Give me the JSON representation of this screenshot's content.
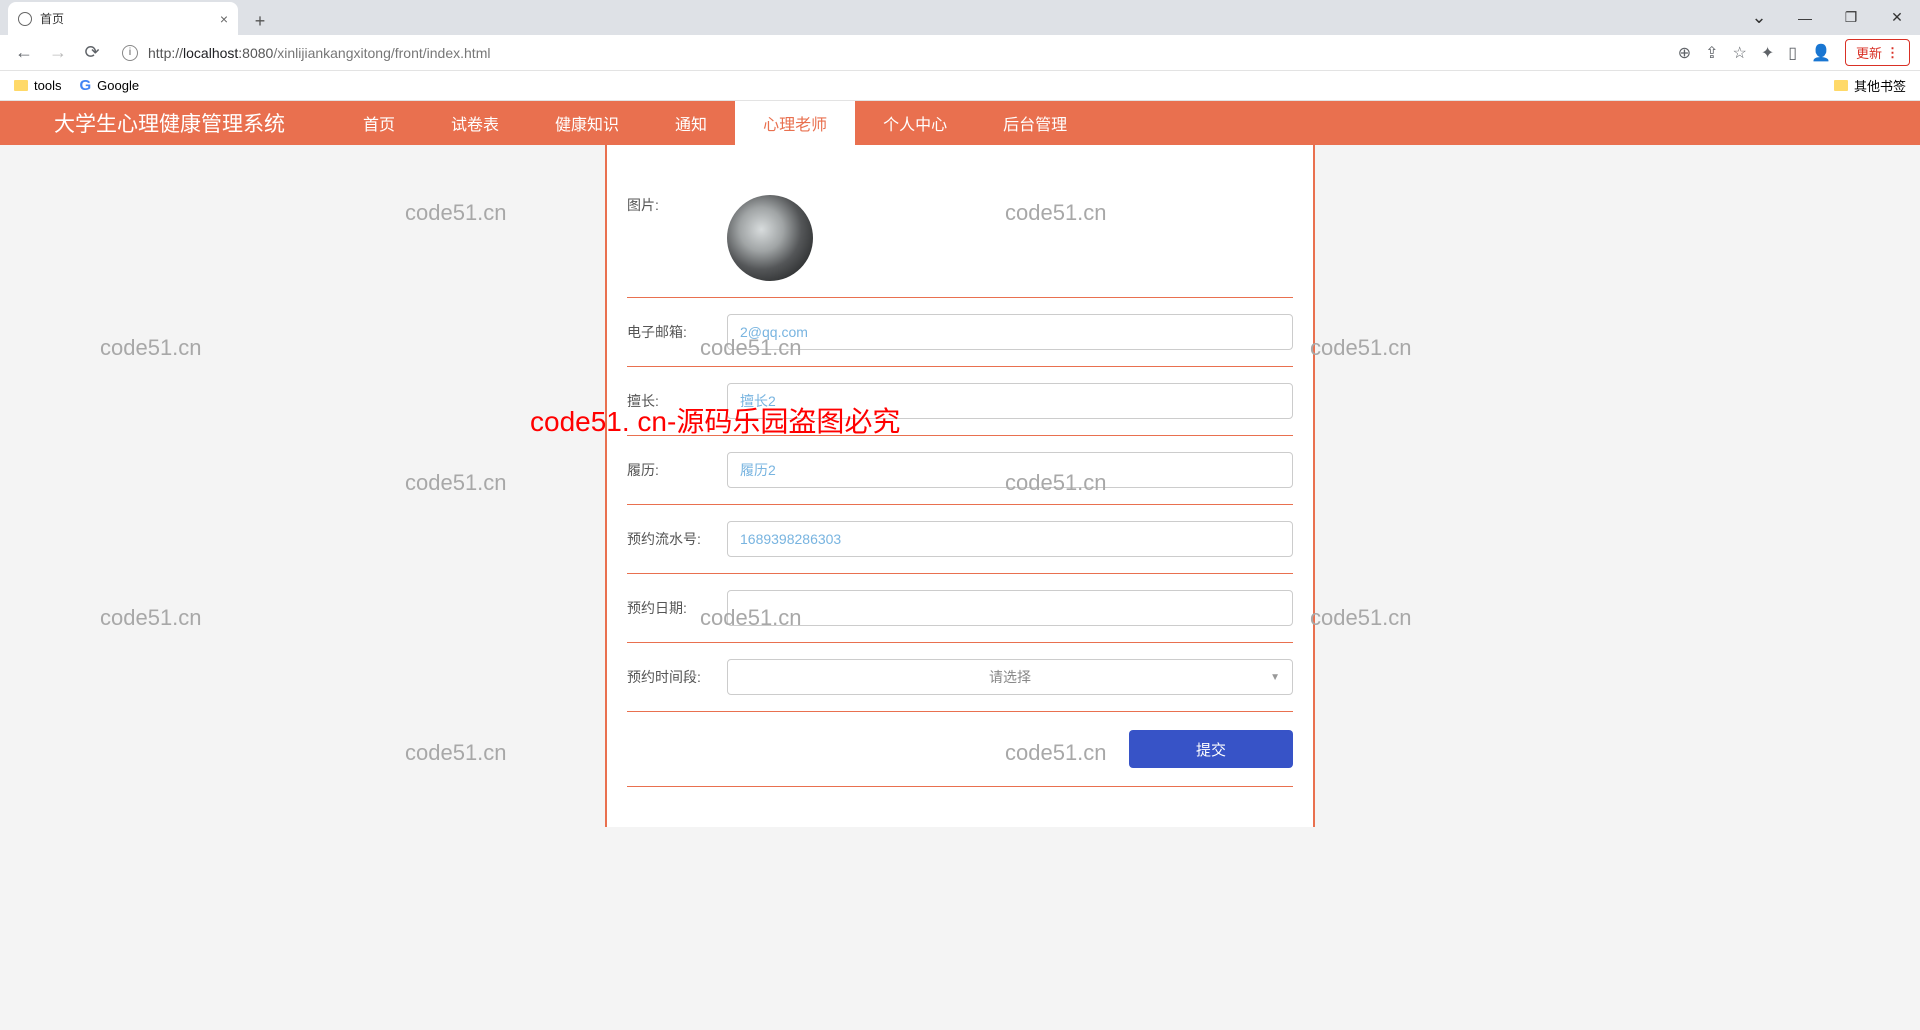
{
  "browser": {
    "tab_title": "首页",
    "url_host": "localhost",
    "url_port": ":8080",
    "url_path": "/xinlijiankangxitong/front/index.html",
    "update_label": "更新"
  },
  "bookmarks": {
    "tools": "tools",
    "google": "Google",
    "other": "其他书签"
  },
  "header": {
    "site_title": "大学生心理健康管理系统",
    "nav": [
      "首页",
      "试卷表",
      "健康知识",
      "通知",
      "心理老师",
      "个人中心",
      "后台管理"
    ],
    "active_index": 4
  },
  "form": {
    "image_label": "图片:",
    "email_label": "电子邮箱:",
    "email_value": "2@qq.com",
    "specialty_label": "擅长:",
    "specialty_value": "擅长2",
    "resume_label": "履历:",
    "resume_value": "履历2",
    "serial_label": "预约流水号:",
    "serial_value": "1689398286303",
    "date_label": "预约日期:",
    "date_value": "",
    "timeslot_label": "预约时间段:",
    "timeslot_placeholder": "请选择",
    "submit_label": "提交"
  },
  "watermarks": {
    "text": "code51.cn",
    "red_text": "code51. cn-源码乐园盗图必究"
  }
}
